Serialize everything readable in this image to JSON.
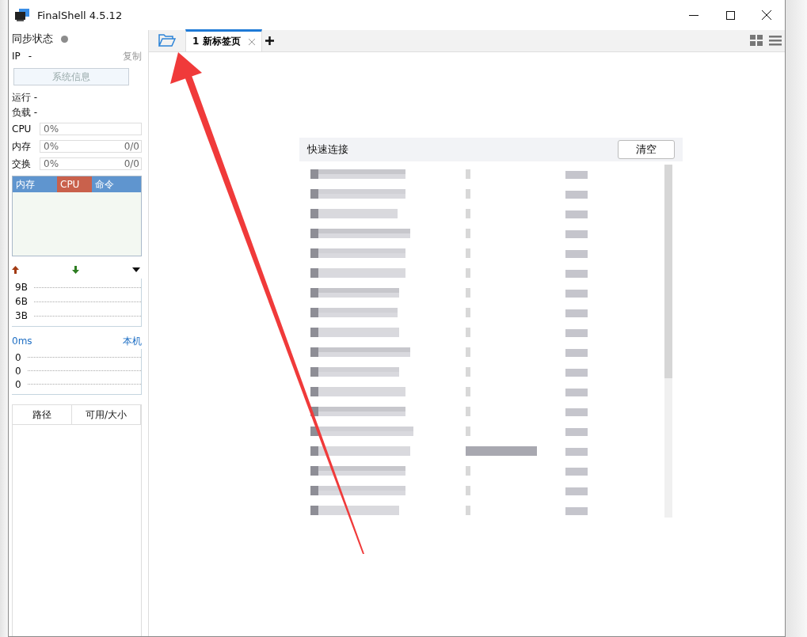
{
  "window": {
    "title": "FinalShell 4.5.12"
  },
  "sidebar": {
    "sync_label": "同步状态",
    "sync_online": false,
    "ip_label": "IP",
    "ip_value": "-",
    "copy": "复制",
    "sysinfo_button": "系统信息",
    "info": [
      "运行 -",
      "负载 -"
    ],
    "meters": [
      {
        "label": "CPU",
        "percent": "0%",
        "level": 0
      },
      {
        "label": "内存",
        "percent": "0%",
        "amount": "0/0",
        "level": 0
      },
      {
        "label": "交换",
        "percent": "0%",
        "amount": "0/0",
        "level": 0
      }
    ],
    "process_columns": [
      {
        "label": "内存",
        "selected": false
      },
      {
        "label": "CPU",
        "selected": true
      },
      {
        "label": "命令",
        "selected": false
      }
    ],
    "net_ticks": [
      "9B",
      "6B",
      "3B"
    ],
    "ping": {
      "latency": "0ms",
      "host": "本机",
      "ticks": [
        "0",
        "0",
        "0"
      ]
    },
    "disk_columns": [
      "路径",
      "可用/大小"
    ]
  },
  "tabs": [
    {
      "label": "1 新标签页",
      "selected": true
    }
  ],
  "quick_connect": {
    "title": "快速连接",
    "clear_button": "清空"
  }
}
